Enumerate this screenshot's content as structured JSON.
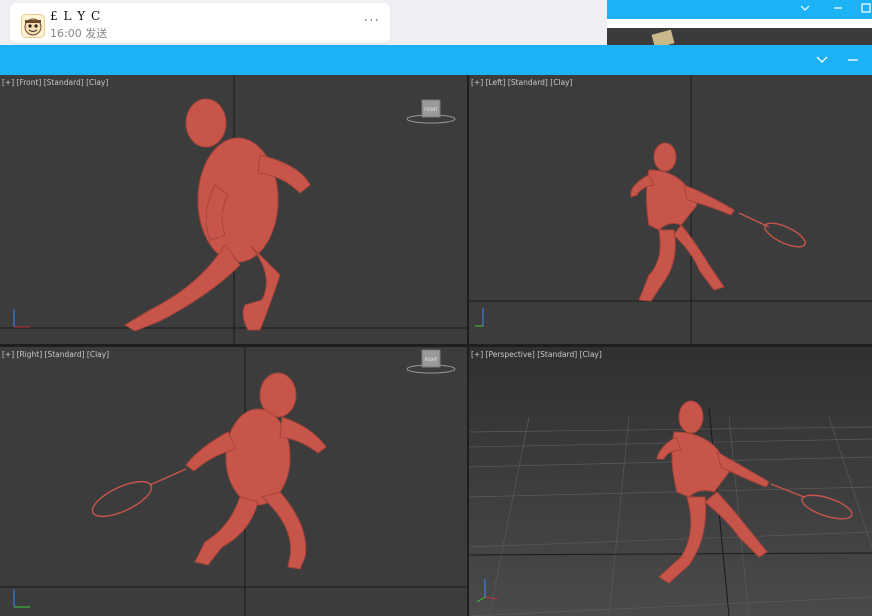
{
  "chat": {
    "name": "£ L Y C",
    "time": "16:00",
    "status": "发送",
    "more": "···"
  },
  "window": {
    "collapse_icon": "chevron-down-icon",
    "minimize_icon": "minimize-icon"
  },
  "viewports": [
    {
      "plus": "[+]",
      "view": "[Front]",
      "shading": "[Standard]",
      "style": "[Clay]",
      "cube": "FRONT"
    },
    {
      "plus": "[+]",
      "view": "[Left]",
      "shading": "[Standard]",
      "style": "[Clay]"
    },
    {
      "plus": "[+]",
      "view": "[Right]",
      "shading": "[Standard]",
      "style": "[Clay]",
      "cube": "RIGHT"
    },
    {
      "plus": "[+]",
      "view": "[Perspective]",
      "shading": "[Standard]",
      "style": "[Clay]"
    }
  ],
  "colors": {
    "titlebar": "#1cb2f5",
    "viewport_bg": "#3c3c3c",
    "model": "#c8554a",
    "active_border": "#c8b46a"
  }
}
